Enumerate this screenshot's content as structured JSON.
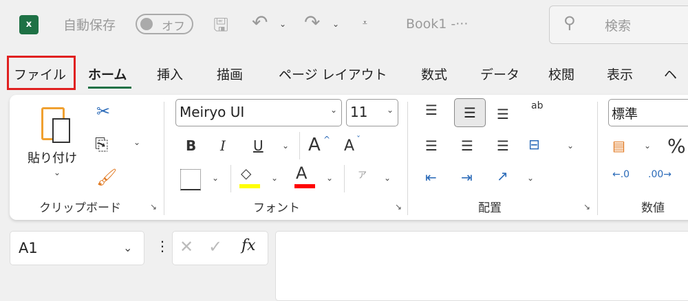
{
  "titlebar": {
    "autosave_label": "自動保存",
    "autosave_toggle": "オフ",
    "autosave_on": false,
    "doc_title": "Book1 -···",
    "search_placeholder": "検索"
  },
  "tabs": [
    {
      "label": "ファイル",
      "highlighted": true
    },
    {
      "label": "ホーム",
      "active": true
    },
    {
      "label": "挿入"
    },
    {
      "label": "描画"
    },
    {
      "label": "ページ レイアウト"
    },
    {
      "label": "数式"
    },
    {
      "label": "データ"
    },
    {
      "label": "校閲"
    },
    {
      "label": "表示"
    },
    {
      "label": "ヘ"
    }
  ],
  "ribbon": {
    "clipboard": {
      "label": "クリップボード",
      "paste_label": "貼り付け"
    },
    "font": {
      "label": "フォント",
      "font_name": "Meiryo UI",
      "font_size": "11",
      "bold": "B",
      "italic": "I",
      "underline": "U",
      "grow": "A",
      "shrink": "A",
      "font_color": "A",
      "phonetic": "ア"
    },
    "alignment": {
      "label": "配置",
      "wrap": "ab"
    },
    "number": {
      "label": "数値",
      "format": "標準",
      "percent": "%"
    }
  },
  "colors": {
    "highlight_box": "#e02020",
    "active_tab_underline": "#1e7145",
    "fill_color": "#ffff00",
    "font_color": "#ff0000"
  },
  "formula_bar": {
    "name_box": "A1",
    "fx": "fx",
    "formula": ""
  }
}
